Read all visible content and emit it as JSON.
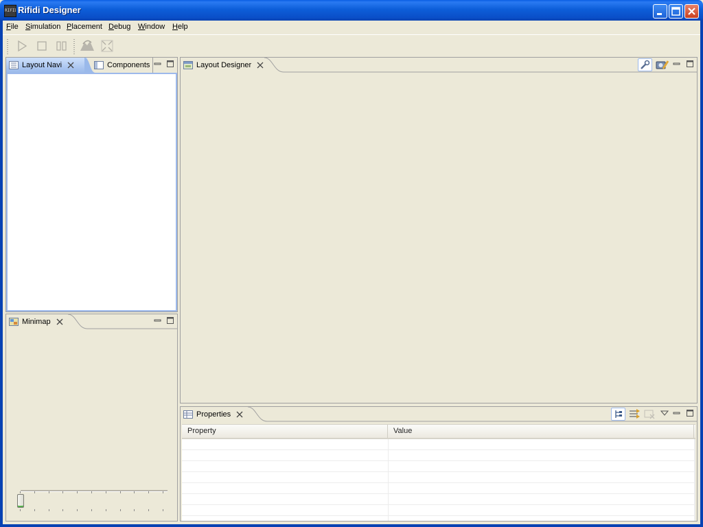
{
  "window": {
    "title": "Rifidi Designer",
    "app_icon_text": "RIFIDI"
  },
  "menu": [
    {
      "key": "F",
      "rest": "ile"
    },
    {
      "key": "S",
      "rest": "imulation"
    },
    {
      "key": "P",
      "rest": "lacement"
    },
    {
      "key": "D",
      "rest": "ebug"
    },
    {
      "key": "W",
      "rest": "indow"
    },
    {
      "key": "H",
      "rest": "elp"
    }
  ],
  "toolbar": {
    "items": [
      "play-icon",
      "stop-icon",
      "pause-icon",
      "rotate-icon",
      "fullscreen-icon"
    ],
    "enabled": false
  },
  "panels": {
    "navigator": {
      "tabs": [
        "Layout Navi",
        "Components"
      ],
      "active": 0
    },
    "minimap": {
      "tab": "Minimap",
      "zoom_ticks": 11
    },
    "designer": {
      "tab": "Layout Designer"
    },
    "properties": {
      "tab": "Properties",
      "columns": [
        "Property",
        "Value"
      ],
      "empty_rows": 7
    }
  },
  "colors": {
    "title_blue": "#0a5de4",
    "frame": "#ece9d8",
    "tab_highlight": "#9ab9ea",
    "close_red": "#c9401e"
  }
}
